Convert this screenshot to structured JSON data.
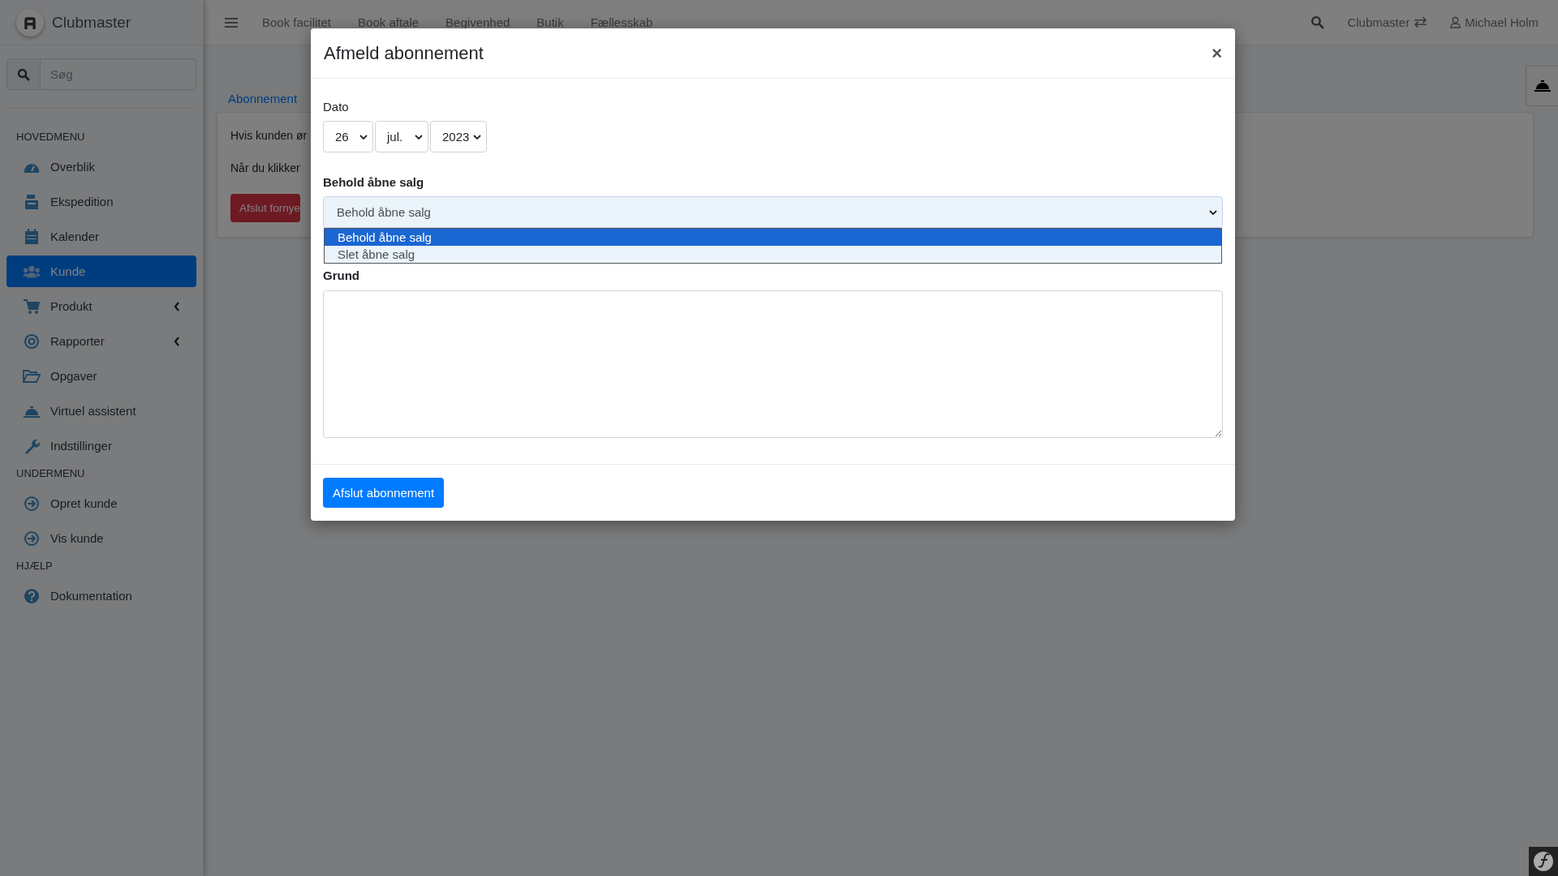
{
  "brand": {
    "name": "Clubmaster"
  },
  "sidebar": {
    "search": {
      "placeholder": "Søg"
    },
    "sections": [
      {
        "title": "HOVEDMENU",
        "items": [
          {
            "label": "Overblik",
            "kind": "gauge",
            "selected": false,
            "submenu": false
          },
          {
            "label": "Ekspedition",
            "kind": "register",
            "selected": false,
            "submenu": false
          },
          {
            "label": "Kalender",
            "kind": "calendar",
            "selected": false,
            "submenu": false
          },
          {
            "label": "Kunde",
            "kind": "users",
            "selected": true,
            "submenu": false
          },
          {
            "label": "Produkt",
            "kind": "cart",
            "selected": false,
            "submenu": true
          },
          {
            "label": "Rapporter",
            "kind": "target",
            "selected": false,
            "submenu": true
          },
          {
            "label": "Opgaver",
            "kind": "folder",
            "selected": false,
            "submenu": false
          },
          {
            "label": "Virtuel assistent",
            "kind": "bell",
            "selected": false,
            "submenu": false
          },
          {
            "label": "Indstillinger",
            "kind": "wrench",
            "selected": false,
            "submenu": false
          }
        ]
      },
      {
        "title": "UNDERMENU",
        "items": [
          {
            "label": "Opret kunde",
            "kind": "arrow",
            "selected": false,
            "submenu": false
          },
          {
            "label": "Vis kunde",
            "kind": "arrow",
            "selected": false,
            "submenu": false
          }
        ]
      },
      {
        "title": "HJÆLP",
        "items": [
          {
            "label": "Dokumentation",
            "kind": "question",
            "selected": false,
            "submenu": false
          }
        ]
      }
    ]
  },
  "topbar": {
    "nav": [
      "Book facilitet",
      "Book aftale",
      "Begivenhed",
      "Butik",
      "Fællesskab"
    ],
    "club": "Clubmaster",
    "user": "Michael Holm"
  },
  "content": {
    "tab": "Abonnement",
    "paragraphs": [
      "Hvis kunden ør",
      "Når du klikker"
    ],
    "button": "Afslut fornye"
  },
  "modal": {
    "title": "Afmeld abonnement",
    "close": "×",
    "date": {
      "label": "Dato",
      "selects": [
        {
          "value": "26"
        },
        {
          "value": "jul."
        },
        {
          "value": "2023"
        }
      ]
    },
    "keep_sales": {
      "label": "Behold åbne salg",
      "value": "Behold åbne salg",
      "expanded": true,
      "options": [
        {
          "label": "Behold åbne salg",
          "selected": true
        },
        {
          "label": "Slet åbne salg",
          "selected": false
        }
      ]
    },
    "reason": {
      "label": "Grund"
    },
    "submit": "Afslut abonnement"
  }
}
